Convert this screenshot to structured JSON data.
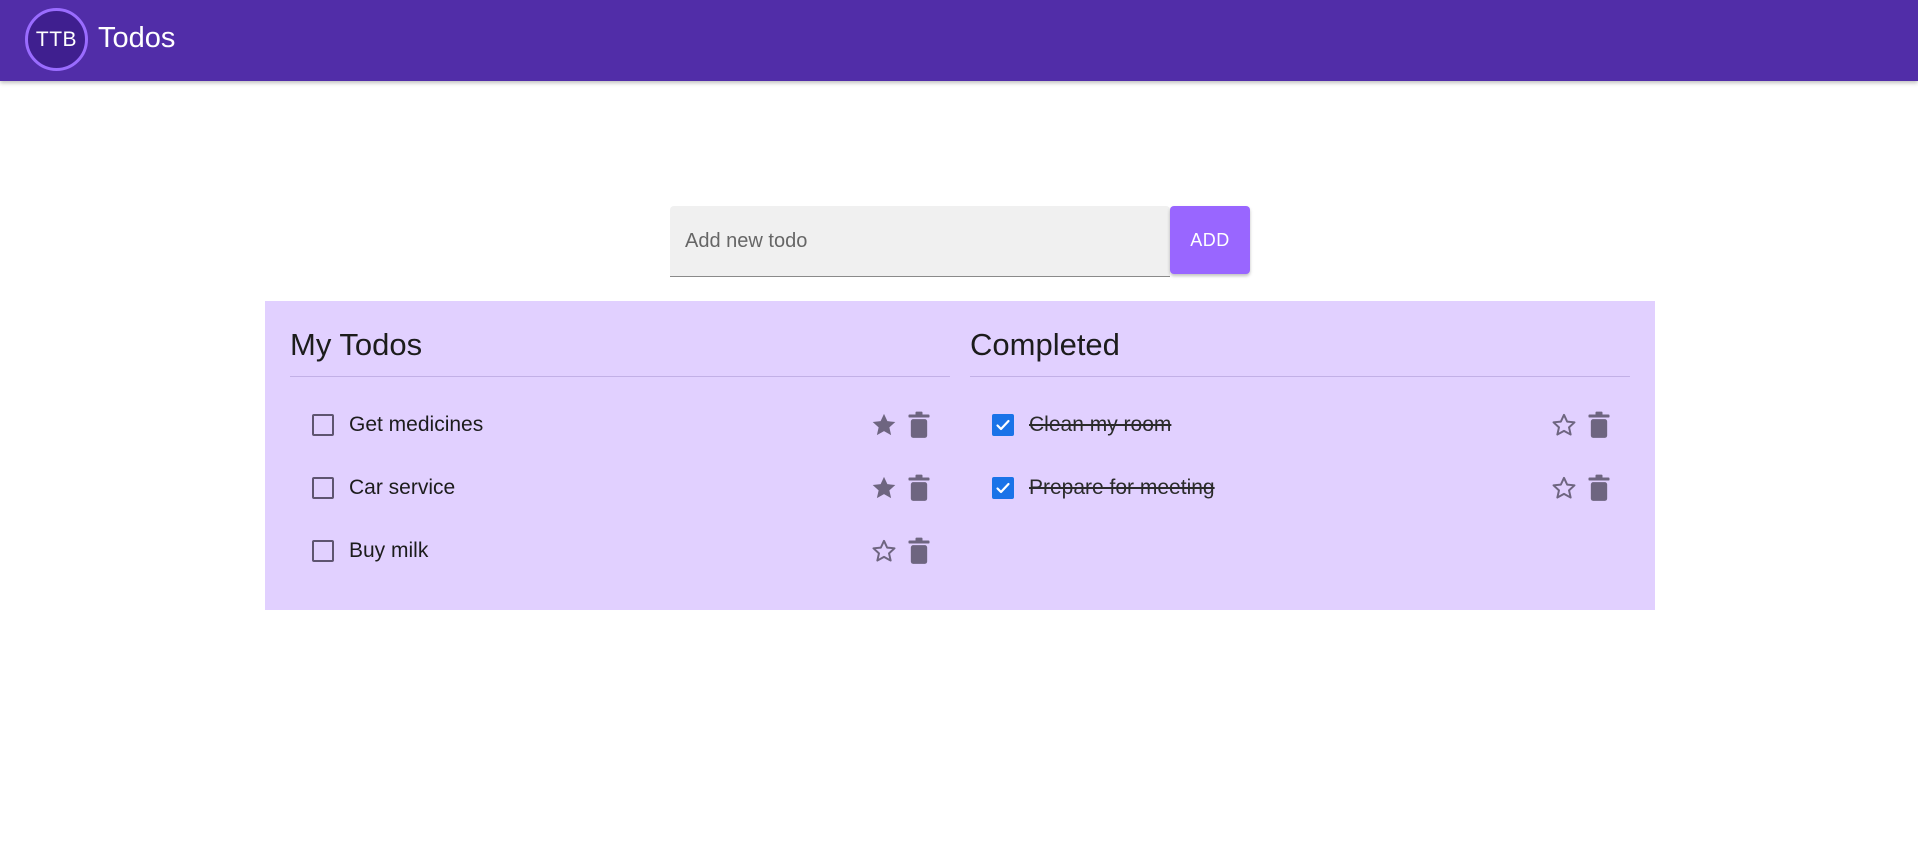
{
  "appbar": {
    "avatar_text": "TTB",
    "title": "Todos",
    "color": "#512da8"
  },
  "add_form": {
    "placeholder": "Add new todo",
    "value": "",
    "button_label": "ADD",
    "button_color": "#9966ff"
  },
  "board": {
    "background": "#e1d0ff",
    "my_todos": {
      "title": "My Todos",
      "items": [
        {
          "text": "Get medicines",
          "checked": false,
          "starred": true
        },
        {
          "text": "Car service",
          "checked": false,
          "starred": true
        },
        {
          "text": "Buy milk",
          "checked": false,
          "starred": false
        }
      ]
    },
    "completed": {
      "title": "Completed",
      "items": [
        {
          "text": "Clean my room",
          "checked": true,
          "starred": false
        },
        {
          "text": "Prepare for meeting",
          "checked": true,
          "starred": false
        }
      ]
    }
  },
  "icons": {
    "star": "star-icon",
    "trash": "trash-icon",
    "check": "check-icon"
  },
  "colors": {
    "icon": "#6e6580",
    "checkbox_checked": "#1a73e8"
  }
}
